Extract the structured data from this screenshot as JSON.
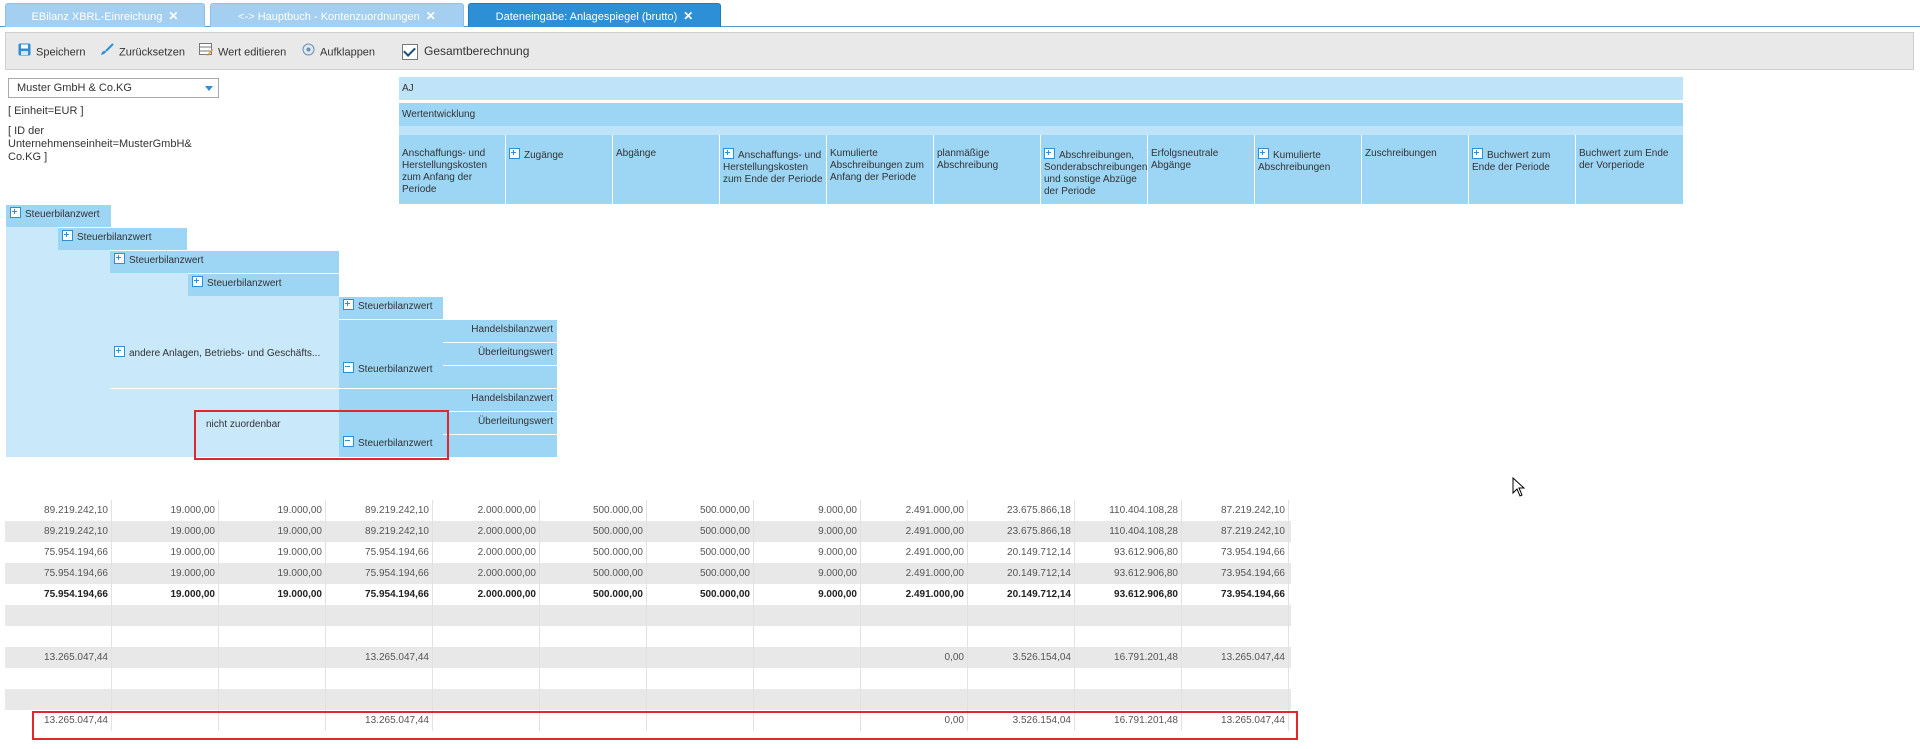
{
  "tabs": [
    {
      "label": "EBilanz XBRL-Einreichung",
      "close": "✕"
    },
    {
      "label": "<-> Hauptbuch - Kontenzuordnungen",
      "close": "✕"
    },
    {
      "label": "Dateneingabe: Anlagespiegel (brutto)",
      "close": "✕"
    }
  ],
  "toolbar": {
    "save": "Speichern",
    "reset": "Zurücksetzen",
    "edit": "Wert editieren",
    "expand": "Aufklappen",
    "total": "Gesamtberechnung"
  },
  "company_select": {
    "value": "Muster GmbH & Co.KG"
  },
  "unit": "[ Einheit=EUR ]",
  "entity_id": "[ ID der Unternehmenseinheit=MusterGmbH& Co.KG ]",
  "header": {
    "aj": "AJ",
    "wertentwicklung": "Wertentwicklung",
    "columns": [
      "Anschaffungs- und Herstellungskosten zum Anfang der Periode",
      "Zugänge",
      "Abgänge",
      "Anschaffungs- und Herstellungskosten zum Ende der Periode",
      "Kumulierte Abschreibungen zum Anfang der Periode",
      "planmäßige Abschreibung",
      "Abschreibungen, Sonderabschreibungen und sonstige Abzüge der Periode",
      "Erfolgsneutrale Abgänge",
      "Kumulierte Abschreibungen",
      "Zuschreibungen",
      "Buchwert zum Ende der Periode",
      "Buchwert zum Ende der Vorperiode"
    ]
  },
  "tree": {
    "l1": "Steuerbilanzwert",
    "l2": "Steuerbilanzwert",
    "l3": "Steuerbilanzwert",
    "l4": "Steuerbilanzwert",
    "l5": "Steuerbilanzwert",
    "group1_label": "andere Anlagen, Betriebs- und Geschäfts...",
    "group1_sub1": "Handelsbilanzwert",
    "group1_sub2": "Überleitungswert",
    "group1_sub3": "Steuerbilanzwert",
    "group2_label": "nicht zuordenbar",
    "group2_sub1": "Handelsbilanzwert",
    "group2_sub2": "Überleitungswert",
    "group2_sub3": "Steuerbilanzwert"
  },
  "grid": [
    [
      "89.219.242,10",
      "19.000,00",
      "19.000,00",
      "89.219.242,10",
      "2.000.000,00",
      "500.000,00",
      "500.000,00",
      "9.000,00",
      "2.491.000,00",
      "23.675.866,18",
      "110.404.108,28",
      "87.219.242,10"
    ],
    [
      "89.219.242,10",
      "19.000,00",
      "19.000,00",
      "89.219.242,10",
      "2.000.000,00",
      "500.000,00",
      "500.000,00",
      "9.000,00",
      "2.491.000,00",
      "23.675.866,18",
      "110.404.108,28",
      "87.219.242,10"
    ],
    [
      "75.954.194,66",
      "19.000,00",
      "19.000,00",
      "75.954.194,66",
      "2.000.000,00",
      "500.000,00",
      "500.000,00",
      "9.000,00",
      "2.491.000,00",
      "20.149.712,14",
      "93.612.906,80",
      "73.954.194,66"
    ],
    [
      "75.954.194,66",
      "19.000,00",
      "19.000,00",
      "75.954.194,66",
      "2.000.000,00",
      "500.000,00",
      "500.000,00",
      "9.000,00",
      "2.491.000,00",
      "20.149.712,14",
      "93.612.906,80",
      "73.954.194,66"
    ],
    [
      "75.954.194,66",
      "19.000,00",
      "19.000,00",
      "75.954.194,66",
      "2.000.000,00",
      "500.000,00",
      "500.000,00",
      "9.000,00",
      "2.491.000,00",
      "20.149.712,14",
      "93.612.906,80",
      "73.954.194,66"
    ],
    [
      "",
      "",
      "",
      "",
      "",
      "",
      "",
      "",
      "",
      "",
      "",
      ""
    ],
    [
      "",
      "",
      "",
      "",
      "",
      "",
      "",
      "",
      "",
      "",
      "",
      ""
    ],
    [
      "13.265.047,44",
      "",
      "",
      "13.265.047,44",
      "",
      "",
      "",
      "",
      "0,00",
      "3.526.154,04",
      "16.791.201,48",
      "13.265.047,44"
    ],
    [
      "",
      "",
      "",
      "",
      "",
      "",
      "",
      "",
      "",
      "",
      "",
      ""
    ],
    [
      "",
      "",
      "",
      "",
      "",
      "",
      "",
      "",
      "",
      "",
      "",
      ""
    ],
    [
      "13.265.047,44",
      "",
      "",
      "13.265.047,44",
      "",
      "",
      "",
      "",
      "0,00",
      "3.526.154,04",
      "16.791.201,48",
      "13.265.047,44"
    ]
  ]
}
